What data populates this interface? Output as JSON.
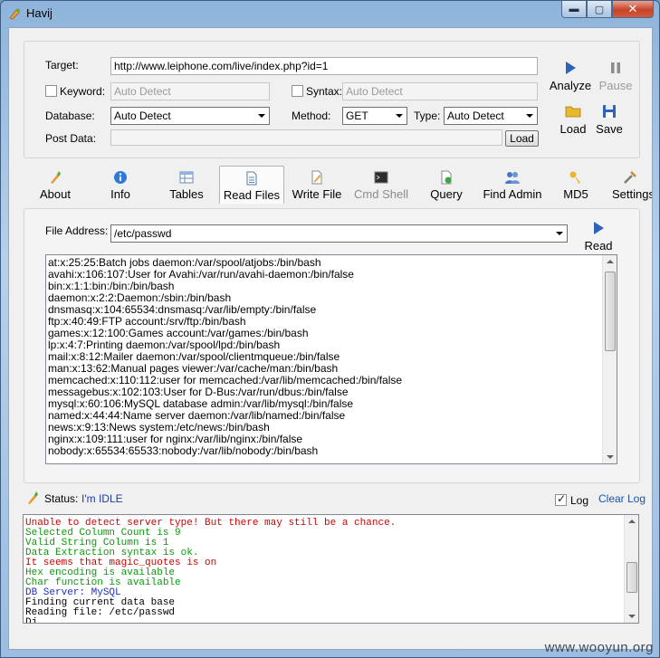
{
  "window": {
    "title": "Havij"
  },
  "titlebar_buttons": {
    "minimize": "▬",
    "maximize": "▢",
    "close": "✕"
  },
  "target_panel": {
    "target_label": "Target:",
    "target_value": "http://www.leiphone.com/live/index.php?id=1",
    "keyword_label": "Keyword:",
    "keyword_placeholder": "Auto Detect",
    "syntax_label": "Syntax:",
    "syntax_placeholder": "Auto Detect",
    "database_label": "Database:",
    "database_value": "Auto Detect",
    "method_label": "Method:",
    "method_value": "GET",
    "type_label": "Type:",
    "type_value": "Auto Detect",
    "post_data_label": "Post Data:",
    "load_button": "Load"
  },
  "actions": {
    "analyze": "Analyze",
    "pause": "Pause",
    "load": "Load",
    "save": "Save"
  },
  "tabs": [
    {
      "label": "About"
    },
    {
      "label": "Info"
    },
    {
      "label": "Tables"
    },
    {
      "label": "Read Files"
    },
    {
      "label": "Write File"
    },
    {
      "label": "Cmd Shell"
    },
    {
      "label": "Query"
    },
    {
      "label": "Find Admin"
    },
    {
      "label": "MD5"
    },
    {
      "label": "Settings"
    }
  ],
  "read_files": {
    "file_address_label": "File Address:",
    "file_address_value": "/etc/passwd",
    "read_button": "Read",
    "lines": [
      "at:x:25:25:Batch jobs daemon:/var/spool/atjobs:/bin/bash",
      "avahi:x:106:107:User for Avahi:/var/run/avahi-daemon:/bin/false",
      "bin:x:1:1:bin:/bin:/bin/bash",
      "daemon:x:2:2:Daemon:/sbin:/bin/bash",
      "dnsmasq:x:104:65534:dnsmasq:/var/lib/empty:/bin/false",
      "ftp:x:40:49:FTP account:/srv/ftp:/bin/bash",
      "games:x:12:100:Games account:/var/games:/bin/bash",
      "lp:x:4:7:Printing daemon:/var/spool/lpd:/bin/bash",
      "mail:x:8:12:Mailer daemon:/var/spool/clientmqueue:/bin/false",
      "man:x:13:62:Manual pages viewer:/var/cache/man:/bin/bash",
      "memcached:x:110:112:user for memcached:/var/lib/memcached:/bin/false",
      "messagebus:x:102:103:User for D-Bus:/var/run/dbus:/bin/false",
      "mysql:x:60:106:MySQL database admin:/var/lib/mysql:/bin/false",
      "named:x:44:44:Name server daemon:/var/lib/named:/bin/false",
      "news:x:9:13:News system:/etc/news:/bin/bash",
      "nginx:x:109:111:user for nginx:/var/lib/nginx:/bin/false",
      "nobody:x:65534:65533:nobody:/var/lib/nobody:/bin/bash"
    ]
  },
  "status_bar": {
    "status_label": "Status:",
    "status_value": "I'm IDLE",
    "log_label": "Log",
    "clear_log": "Clear Log"
  },
  "log": {
    "lines": [
      {
        "text": "Unable to detect server type! But there may still be a chance.",
        "color": "#d00000"
      },
      {
        "text": "Selected Column Count is 9",
        "color": "#0a9a0a"
      },
      {
        "text": "Valid String Column is 1",
        "color": "#0a9a0a"
      },
      {
        "text": "Data Extraction syntax is ok.",
        "color": "#0a9a0a"
      },
      {
        "text": "It seems that magic_quotes is on",
        "color": "#d00000"
      },
      {
        "text": "Hex encoding is available",
        "color": "#0a9a0a"
      },
      {
        "text": "Char function is available",
        "color": "#0a9a0a"
      },
      {
        "text": "DB Server: MySQL",
        "color": "#1a2fd0"
      },
      {
        "text": "Finding current data base",
        "color": "#000000"
      },
      {
        "text": "Reading file: /etc/passwd",
        "color": "#000000"
      },
      {
        "text": "Dj...",
        "color": "#000000"
      }
    ]
  },
  "watermark": "www.wooyun.org"
}
